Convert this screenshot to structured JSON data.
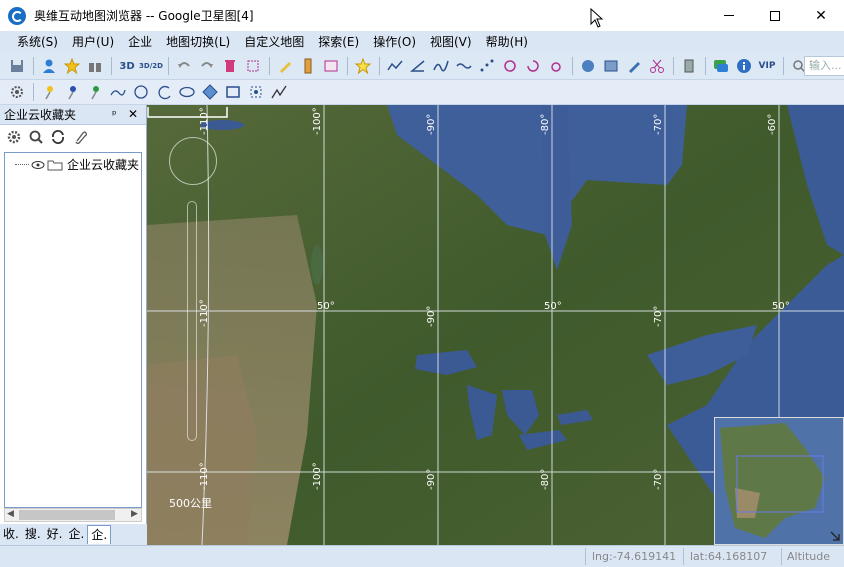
{
  "window": {
    "title": "奥维互动地图浏览器 -- Google卫星图[4]",
    "minimize": "—",
    "maximize": "☐",
    "close": "✕"
  },
  "menubar": {
    "items": [
      "系统(S)",
      "用户(U)",
      "企业",
      "地图切换(L)",
      "自定义地图",
      "探索(E)",
      "操作(O)",
      "视图(V)",
      "帮助(H)"
    ]
  },
  "toolbar1": {
    "label_3d": "3D",
    "label_3d2d": "3D/2D",
    "label_vip": "VIP",
    "search_placeholder": "输入...",
    "icons": [
      "save-icon",
      "user-icon",
      "star-icon",
      "binoculars-icon",
      "3d-icon",
      "3d2d-icon",
      "undo-icon",
      "redo-icon",
      "delete-icon",
      "select-icon",
      "pencil-icon",
      "ruler-icon",
      "screen-icon",
      "star-add-icon",
      "track-icon",
      "angle-icon",
      "path-icon",
      "wave-icon",
      "dots-icon",
      "circle-arrow-icon",
      "rotate-icon",
      "link-icon",
      "globe-icon",
      "layers-icon",
      "edit-icon",
      "scissors-icon",
      "building-icon",
      "chat-icon",
      "info-icon",
      "vip-icon",
      "search-icon"
    ]
  },
  "toolbar2": {
    "icons": [
      "settings-icon",
      "pin-yellow-icon",
      "pin-blue-icon",
      "pin-green-icon",
      "line-icon",
      "circle-icon",
      "arc-icon",
      "ellipse-icon",
      "diamond-icon",
      "rectangle-icon",
      "points-icon",
      "polyline-icon"
    ]
  },
  "leftpanel": {
    "title": "企业云收藏夹",
    "pin": "ᵖ",
    "close": "✕",
    "tree_item": "企业云收藏夹",
    "tabs": [
      "收.",
      "搜.",
      "好.",
      "企.",
      "企."
    ]
  },
  "map": {
    "grid_labels_top": [
      "-110°",
      "-100°",
      "-90°",
      "-80°",
      "-70°",
      "-60°"
    ],
    "grid_labels_mid": [
      "-110°",
      "50°",
      "-90°",
      "50°",
      "-70°",
      "50°"
    ],
    "grid_labels_bottom": [
      "-110°",
      "-100°",
      "-90°",
      "-80°",
      "-70°"
    ],
    "scale": "500公里"
  },
  "statusbar": {
    "lng": "lng:-74.619141",
    "lat": "lat:64.168107",
    "alt": "Altitude"
  },
  "colors": {
    "menubar": "#dbe6f4",
    "toolbar": "#dde8f5",
    "water": "#3f5f9a",
    "land": "#4a6a3a"
  }
}
